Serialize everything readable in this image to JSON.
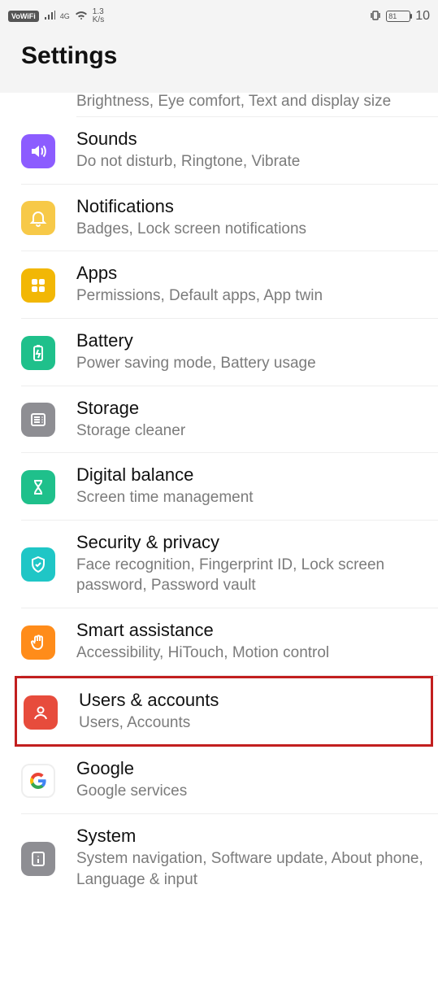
{
  "status": {
    "vowifi": "VoWiFi",
    "net_type": "4G",
    "speed_top": "1.3",
    "speed_bot": "K/s",
    "battery": "81",
    "time": "10"
  },
  "page": {
    "title": "Settings"
  },
  "cutoff_text": "Brightness, Eye comfort, Text and display size",
  "items": {
    "sounds": {
      "title": "Sounds",
      "sub": "Do not disturb, Ringtone, Vibrate"
    },
    "notifications": {
      "title": "Notifications",
      "sub": "Badges, Lock screen notifications"
    },
    "apps": {
      "title": "Apps",
      "sub": "Permissions, Default apps, App twin"
    },
    "battery": {
      "title": "Battery",
      "sub": "Power saving mode, Battery usage"
    },
    "storage": {
      "title": "Storage",
      "sub": "Storage cleaner"
    },
    "digital": {
      "title": "Digital balance",
      "sub": "Screen time management"
    },
    "security": {
      "title": "Security & privacy",
      "sub": "Face recognition, Fingerprint ID, Lock screen password, Password vault"
    },
    "smart": {
      "title": "Smart assistance",
      "sub": "Accessibility, HiTouch, Motion control"
    },
    "users": {
      "title": "Users & accounts",
      "sub": "Users, Accounts"
    },
    "google": {
      "title": "Google",
      "sub": "Google services"
    },
    "system": {
      "title": "System",
      "sub": "System navigation, Software update, About phone, Language & input"
    }
  }
}
